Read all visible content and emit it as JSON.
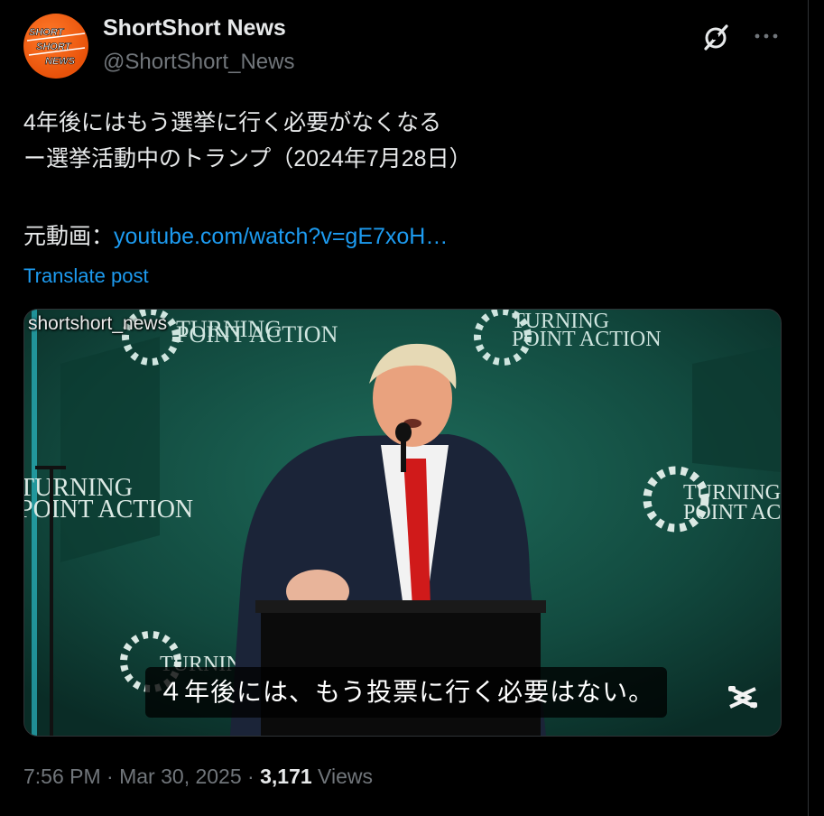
{
  "author": {
    "display_name": "ShortShort News",
    "handle": "@ShortShort_News",
    "avatar_text": [
      "SHORT",
      "SHORT",
      "NEWS"
    ]
  },
  "tweet": {
    "line1": "4年後にはもう選挙に行く必要がなくなる",
    "line2": "ー選挙活動中のトランプ（2024年7月28日）",
    "source_prefix": "元動画：",
    "source_link": "youtube.com/watch?v=gE7xoH…",
    "translate": "Translate post"
  },
  "media": {
    "watermark": "shortshort_news",
    "subtitle": "４年後には、もう投票に行く必要はない。",
    "backdrop_text": [
      "TURNING",
      "POINT ACTION"
    ]
  },
  "meta": {
    "time": "7:56 PM",
    "separator": "·",
    "date": "Mar 30, 2025",
    "views_count": "3,171",
    "views_label": "Views"
  },
  "icons": {
    "grok": "grok-icon",
    "more": "more-icon",
    "capcut": "capcut-icon"
  },
  "colors": {
    "background": "#000000",
    "text": "#e7e9ea",
    "secondary": "#71767b",
    "link": "#1d9bf0",
    "avatar": "#e8520a",
    "stage_green": "#0f3a33"
  }
}
